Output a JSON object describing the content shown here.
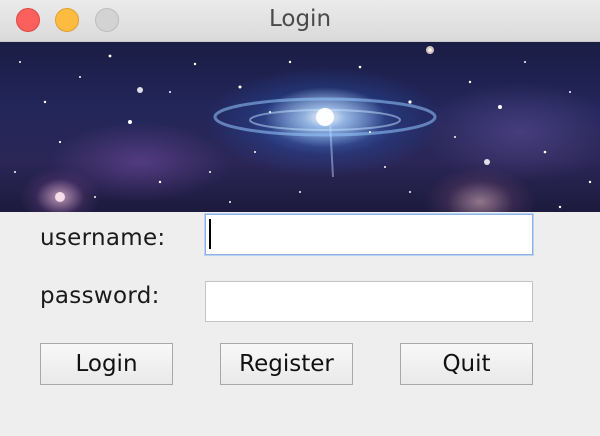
{
  "window": {
    "title": "Login"
  },
  "banner": {
    "description_icon": "galaxy-banner-image"
  },
  "form": {
    "username_label": "username:",
    "username_value": "",
    "password_label": "password:",
    "password_value": ""
  },
  "buttons": {
    "login": "Login",
    "register": "Register",
    "quit": "Quit"
  },
  "colors": {
    "close": "#fc605c",
    "minimize": "#fdbc40",
    "maximize": "#d3d3d3",
    "focus_ring": "#8fb2e6"
  }
}
